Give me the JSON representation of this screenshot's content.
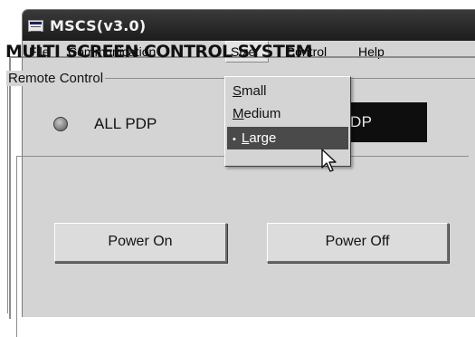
{
  "window": {
    "title": "MSCS(v3.0)",
    "icon": "app-icon"
  },
  "menubar": {
    "items": [
      {
        "pre": "",
        "u": "F",
        "post": "ile"
      },
      {
        "pre": "",
        "u": "C",
        "post": "ommunication"
      },
      {
        "pre": "S",
        "u": "i",
        "post": "ze"
      },
      {
        "pre": "C",
        "u": "o",
        "post": "ntrol"
      },
      {
        "pre": "",
        "u": "H",
        "post": "elp"
      }
    ]
  },
  "size_menu": {
    "items": [
      {
        "u": "S",
        "post": "mall",
        "checked": false
      },
      {
        "u": "M",
        "post": "edium",
        "checked": false
      },
      {
        "u": "L",
        "post": "arge",
        "checked": true
      }
    ],
    "bullet": "•"
  },
  "main": {
    "heading": "MULTI SCREEN CONTROL SYSTEM",
    "remote_group_label": "Remote Control",
    "all_pdp_label": "ALL PDP",
    "orion_pdp_label": "Orion PDP",
    "power_on_label": "Power On",
    "power_off_label": "Power Off"
  },
  "colors": {
    "titlebar": "#1c1c1c",
    "face": "#d4d4d4",
    "menu_highlight": "#4a4a4a",
    "orion_button": "#0e0e0e"
  }
}
